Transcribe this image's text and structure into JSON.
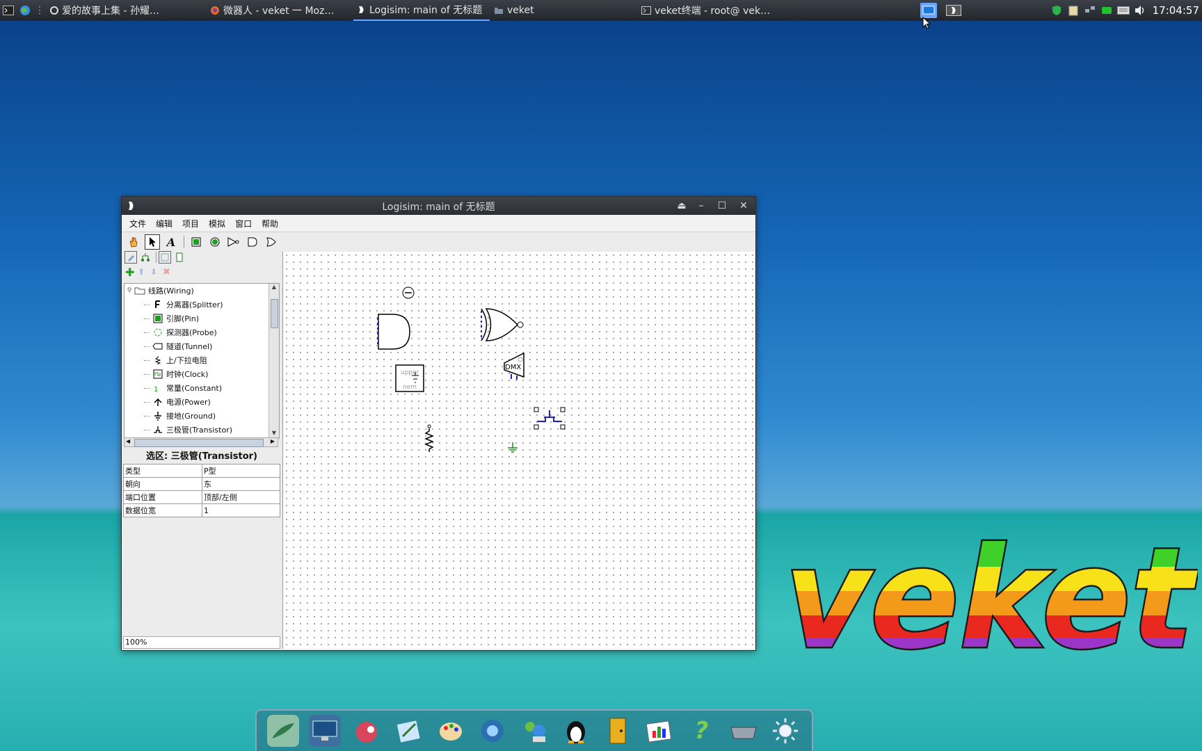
{
  "taskbar": {
    "tasks": [
      {
        "label": "爱的故事上集 - 孙耀…",
        "icon": "media-icon"
      },
      {
        "label": "微器人 - veket 一 Moz…",
        "icon": "firefox-icon"
      },
      {
        "label": "Logisim: main of 无标题",
        "icon": "logisim-icon",
        "active": true
      },
      {
        "label": "veket",
        "icon": "folder-icon"
      },
      {
        "label": "veket终端 - root@ vek…",
        "icon": "terminal-icon"
      }
    ],
    "clock": "17:04:57"
  },
  "window": {
    "title": "Logisim: main of 无标题",
    "menus": [
      "文件",
      "编辑",
      "项目",
      "模拟",
      "窗口",
      "帮助"
    ],
    "tree": {
      "root": "线路(Wiring)",
      "items": [
        "分离器(Splitter)",
        "引脚(Pin)",
        "探测器(Probe)",
        "隧道(Tunnel)",
        "上/下拉电阻",
        "时钟(Clock)",
        "常量(Constant)",
        "电源(Power)",
        "接地(Ground)",
        "三极管(Transistor)"
      ]
    },
    "selection_title": "选区: 三极管(Transistor)",
    "attributes": [
      {
        "name": "类型",
        "value": "P型"
      },
      {
        "name": "朝向",
        "value": "东"
      },
      {
        "name": "端口位置",
        "value": "顶部/左侧"
      },
      {
        "name": "数据位宽",
        "value": "1"
      }
    ],
    "zoom": "100%",
    "canvas_labels": {
      "dmx": "DMX",
      "upper": "upper",
      "lower": "nem"
    }
  },
  "logo": "veket"
}
